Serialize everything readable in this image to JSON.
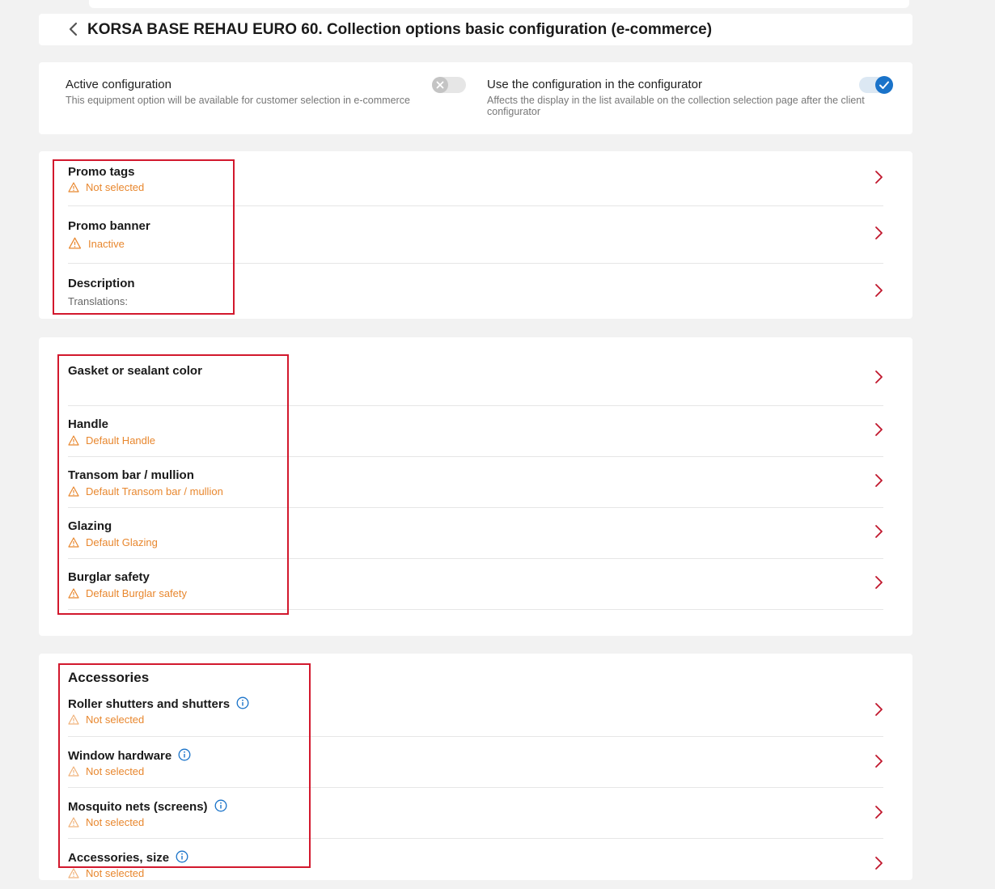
{
  "header": {
    "title": "KORSA BASE REHAU EURO 60. Collection options basic configuration (e-commerce)",
    "back_icon": "chevron-left-icon"
  },
  "settings": {
    "active": {
      "title": "Active configuration",
      "description": "This equipment option will be available for customer selection in e-commerce",
      "enabled": false
    },
    "configurator": {
      "title": "Use the configuration in the configurator",
      "description": "Affects the display in the list available on the collection selection page after the client configurator",
      "enabled": true
    }
  },
  "promo_section": {
    "rows": [
      {
        "title": "Promo tags",
        "status": "Not selected"
      },
      {
        "title": "Promo banner",
        "status": "Inactive"
      },
      {
        "title": "Description",
        "subtitle": "Translations:"
      }
    ]
  },
  "options_section": {
    "rows": [
      {
        "title": "Gasket or sealant color"
      },
      {
        "title": "Handle",
        "status": "Default Handle"
      },
      {
        "title": "Transom bar / mullion",
        "status": "Default Transom bar / mullion"
      },
      {
        "title": "Glazing",
        "status": "Default Glazing"
      },
      {
        "title": "Burglar safety",
        "status": "Default Burglar safety"
      }
    ]
  },
  "accessories_section": {
    "title": "Accessories",
    "rows": [
      {
        "title": "Roller shutters and shutters",
        "status": "Not selected"
      },
      {
        "title": "Window hardware",
        "status": "Not selected"
      },
      {
        "title": "Mosquito nets (screens)",
        "status": "Not selected"
      },
      {
        "title": "Accessories, size",
        "status": "Not selected"
      }
    ]
  },
  "colors": {
    "warning": "#e8872e",
    "accent": "#1a73c9",
    "chevron": "#c0162c",
    "highlight": "#d2182d"
  }
}
